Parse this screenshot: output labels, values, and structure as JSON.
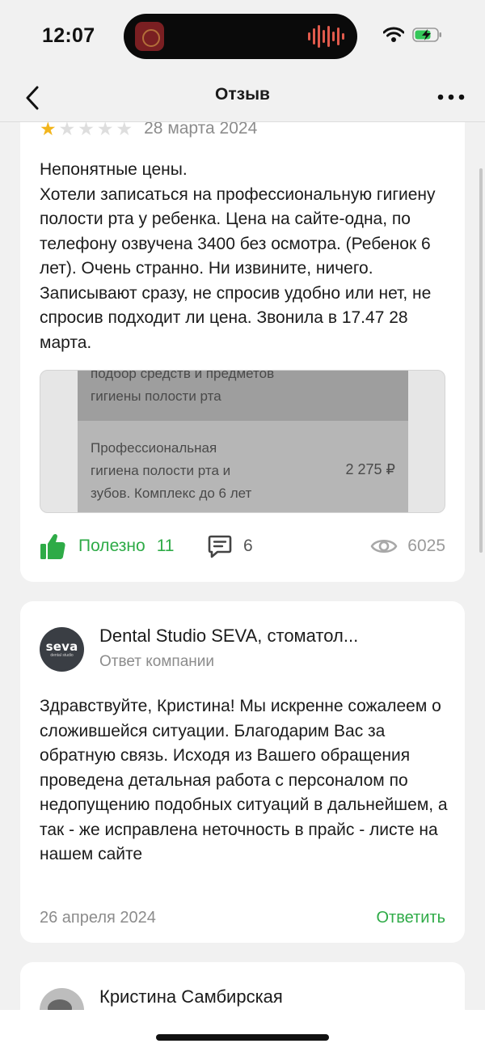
{
  "status_bar": {
    "time": "12:07"
  },
  "nav": {
    "title": "Отзыв"
  },
  "review": {
    "rating": 1,
    "max_rating": 5,
    "date": "28 марта 2024",
    "text": "Непонятные цены.\nХотели записаться на профессиональную гигиену полости рта у ребенка. Цена на сайте-одна, по телефону озвучена 3400 без осмотра. (Ребенок 6 лет). Очень странно. Ни извините, ничего. Записывают сразу, не спросив удобно или нет, не спросив подходит ли цена. Звонила в 17.47 28 марта.",
    "photo": {
      "top_text": "подбор средств и предметов\nгигиены полости рта",
      "item_name": "Профессиональная\nгигиена полости рта и\nзубов. Комплекс до 6 лет",
      "item_price": "2 275 ₽"
    },
    "useful_label": "Полезно",
    "useful_count": "11",
    "comments_count": "6",
    "views_count": "6025"
  },
  "reply": {
    "logo_text": "seva",
    "logo_subtext": "dental studio",
    "company_name": "Dental Studio SEVA, стоматол...",
    "company_subtitle": "Ответ компании",
    "text": "Здравствуйте, Кристина! Мы искренне сожалеем о сложившейся ситуации. Благодарим Вас за обратную связь. Исходя из Вашего обращения проведена детальная работа с персоналом по недопущению подобных ситуаций в дальнейшем, а так - же исправлена неточность в прайс - листе на нашем сайте",
    "date": "26 апреля 2024",
    "answer_label": "Ответить"
  },
  "next_comment": {
    "author": "Кристина Самбирская"
  },
  "colors": {
    "accent_green": "#2eab47",
    "star": "#f2b51c",
    "muted": "#8c8c8c"
  },
  "icons": [
    "back-chevron-icon",
    "more-dots-icon",
    "wifi-icon",
    "battery-charging-icon",
    "thumbs-up-icon",
    "comment-icon",
    "eye-icon"
  ]
}
